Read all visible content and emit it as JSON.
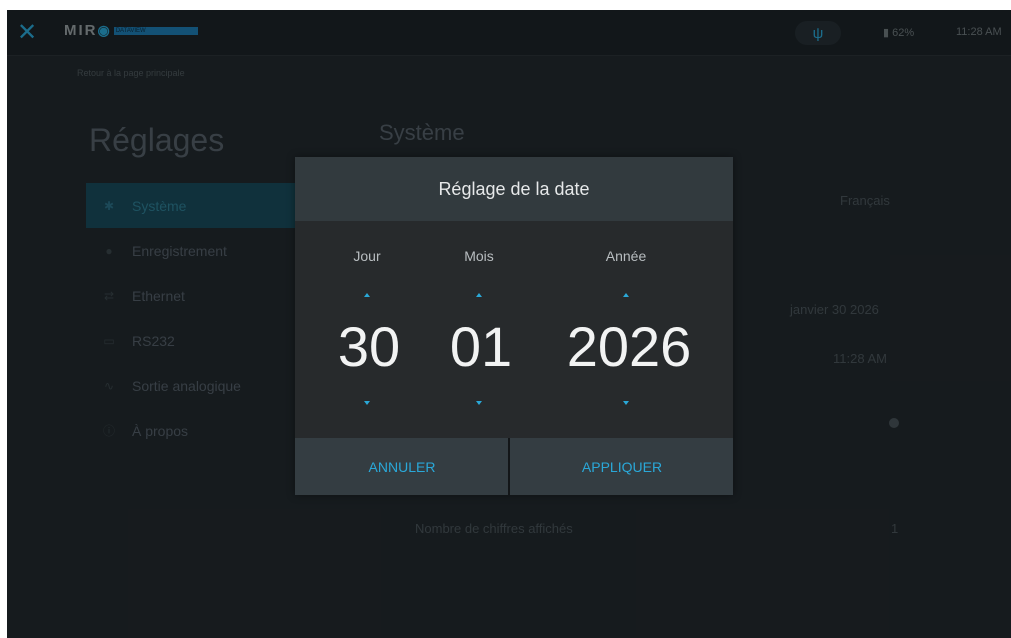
{
  "topbar": {
    "close_icon": "close-icon",
    "logo_text": "MIR",
    "logo_badge": "DATAVIEW",
    "usb_icon": "usb-icon",
    "battery": "62%",
    "time": "11:28 AM"
  },
  "page": {
    "breadcrumb": "Retour à la page principale",
    "title": "Réglages",
    "section_title": "Système"
  },
  "sidebar": {
    "items": [
      {
        "label": "Système",
        "icon": "gear-icon"
      },
      {
        "label": "Enregistrement",
        "icon": "record-icon"
      },
      {
        "label": "Ethernet",
        "icon": "ethernet-icon"
      },
      {
        "label": "RS232",
        "icon": "rs232-icon"
      },
      {
        "label": "Sortie analogique",
        "icon": "analog-icon"
      },
      {
        "label": "À propos",
        "icon": "info-icon"
      }
    ]
  },
  "background": {
    "language": "Français",
    "date": "janvier 30 2026",
    "time": "11:28 AM",
    "digits_label": "Nombre de chiffres affichés",
    "digits_value": "1"
  },
  "dialog": {
    "title": "Réglage de la date",
    "labels": {
      "day": "Jour",
      "month": "Mois",
      "year": "Année"
    },
    "values": {
      "day": "30",
      "month": "01",
      "year": "2026"
    },
    "cancel": "ANNULER",
    "apply": "APPLIQUER"
  },
  "colors": {
    "accent": "#2aa8d8",
    "background": "#232a2e",
    "dialog": "#272a2c"
  }
}
